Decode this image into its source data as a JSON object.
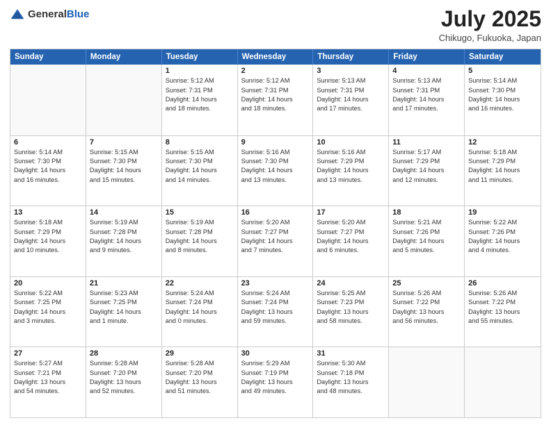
{
  "header": {
    "logo_general": "General",
    "logo_blue": "Blue",
    "month_year": "July 2025",
    "location": "Chikugo, Fukuoka, Japan"
  },
  "days_of_week": [
    "Sunday",
    "Monday",
    "Tuesday",
    "Wednesday",
    "Thursday",
    "Friday",
    "Saturday"
  ],
  "weeks": [
    [
      {
        "day": "",
        "content": []
      },
      {
        "day": "",
        "content": []
      },
      {
        "day": "1",
        "content": [
          "Sunrise: 5:12 AM",
          "Sunset: 7:31 PM",
          "Daylight: 14 hours",
          "and 18 minutes."
        ]
      },
      {
        "day": "2",
        "content": [
          "Sunrise: 5:12 AM",
          "Sunset: 7:31 PM",
          "Daylight: 14 hours",
          "and 18 minutes."
        ]
      },
      {
        "day": "3",
        "content": [
          "Sunrise: 5:13 AM",
          "Sunset: 7:31 PM",
          "Daylight: 14 hours",
          "and 17 minutes."
        ]
      },
      {
        "day": "4",
        "content": [
          "Sunrise: 5:13 AM",
          "Sunset: 7:31 PM",
          "Daylight: 14 hours",
          "and 17 minutes."
        ]
      },
      {
        "day": "5",
        "content": [
          "Sunrise: 5:14 AM",
          "Sunset: 7:30 PM",
          "Daylight: 14 hours",
          "and 16 minutes."
        ]
      }
    ],
    [
      {
        "day": "6",
        "content": [
          "Sunrise: 5:14 AM",
          "Sunset: 7:30 PM",
          "Daylight: 14 hours",
          "and 16 minutes."
        ]
      },
      {
        "day": "7",
        "content": [
          "Sunrise: 5:15 AM",
          "Sunset: 7:30 PM",
          "Daylight: 14 hours",
          "and 15 minutes."
        ]
      },
      {
        "day": "8",
        "content": [
          "Sunrise: 5:15 AM",
          "Sunset: 7:30 PM",
          "Daylight: 14 hours",
          "and 14 minutes."
        ]
      },
      {
        "day": "9",
        "content": [
          "Sunrise: 5:16 AM",
          "Sunset: 7:30 PM",
          "Daylight: 14 hours",
          "and 13 minutes."
        ]
      },
      {
        "day": "10",
        "content": [
          "Sunrise: 5:16 AM",
          "Sunset: 7:29 PM",
          "Daylight: 14 hours",
          "and 13 minutes."
        ]
      },
      {
        "day": "11",
        "content": [
          "Sunrise: 5:17 AM",
          "Sunset: 7:29 PM",
          "Daylight: 14 hours",
          "and 12 minutes."
        ]
      },
      {
        "day": "12",
        "content": [
          "Sunrise: 5:18 AM",
          "Sunset: 7:29 PM",
          "Daylight: 14 hours",
          "and 11 minutes."
        ]
      }
    ],
    [
      {
        "day": "13",
        "content": [
          "Sunrise: 5:18 AM",
          "Sunset: 7:29 PM",
          "Daylight: 14 hours",
          "and 10 minutes."
        ]
      },
      {
        "day": "14",
        "content": [
          "Sunrise: 5:19 AM",
          "Sunset: 7:28 PM",
          "Daylight: 14 hours",
          "and 9 minutes."
        ]
      },
      {
        "day": "15",
        "content": [
          "Sunrise: 5:19 AM",
          "Sunset: 7:28 PM",
          "Daylight: 14 hours",
          "and 8 minutes."
        ]
      },
      {
        "day": "16",
        "content": [
          "Sunrise: 5:20 AM",
          "Sunset: 7:27 PM",
          "Daylight: 14 hours",
          "and 7 minutes."
        ]
      },
      {
        "day": "17",
        "content": [
          "Sunrise: 5:20 AM",
          "Sunset: 7:27 PM",
          "Daylight: 14 hours",
          "and 6 minutes."
        ]
      },
      {
        "day": "18",
        "content": [
          "Sunrise: 5:21 AM",
          "Sunset: 7:26 PM",
          "Daylight: 14 hours",
          "and 5 minutes."
        ]
      },
      {
        "day": "19",
        "content": [
          "Sunrise: 5:22 AM",
          "Sunset: 7:26 PM",
          "Daylight: 14 hours",
          "and 4 minutes."
        ]
      }
    ],
    [
      {
        "day": "20",
        "content": [
          "Sunrise: 5:22 AM",
          "Sunset: 7:25 PM",
          "Daylight: 14 hours",
          "and 3 minutes."
        ]
      },
      {
        "day": "21",
        "content": [
          "Sunrise: 5:23 AM",
          "Sunset: 7:25 PM",
          "Daylight: 14 hours",
          "and 1 minute."
        ]
      },
      {
        "day": "22",
        "content": [
          "Sunrise: 5:24 AM",
          "Sunset: 7:24 PM",
          "Daylight: 14 hours",
          "and 0 minutes."
        ]
      },
      {
        "day": "23",
        "content": [
          "Sunrise: 5:24 AM",
          "Sunset: 7:24 PM",
          "Daylight: 13 hours",
          "and 59 minutes."
        ]
      },
      {
        "day": "24",
        "content": [
          "Sunrise: 5:25 AM",
          "Sunset: 7:23 PM",
          "Daylight: 13 hours",
          "and 58 minutes."
        ]
      },
      {
        "day": "25",
        "content": [
          "Sunrise: 5:26 AM",
          "Sunset: 7:22 PM",
          "Daylight: 13 hours",
          "and 56 minutes."
        ]
      },
      {
        "day": "26",
        "content": [
          "Sunrise: 5:26 AM",
          "Sunset: 7:22 PM",
          "Daylight: 13 hours",
          "and 55 minutes."
        ]
      }
    ],
    [
      {
        "day": "27",
        "content": [
          "Sunrise: 5:27 AM",
          "Sunset: 7:21 PM",
          "Daylight: 13 hours",
          "and 54 minutes."
        ]
      },
      {
        "day": "28",
        "content": [
          "Sunrise: 5:28 AM",
          "Sunset: 7:20 PM",
          "Daylight: 13 hours",
          "and 52 minutes."
        ]
      },
      {
        "day": "29",
        "content": [
          "Sunrise: 5:28 AM",
          "Sunset: 7:20 PM",
          "Daylight: 13 hours",
          "and 51 minutes."
        ]
      },
      {
        "day": "30",
        "content": [
          "Sunrise: 5:29 AM",
          "Sunset: 7:19 PM",
          "Daylight: 13 hours",
          "and 49 minutes."
        ]
      },
      {
        "day": "31",
        "content": [
          "Sunrise: 5:30 AM",
          "Sunset: 7:18 PM",
          "Daylight: 13 hours",
          "and 48 minutes."
        ]
      },
      {
        "day": "",
        "content": []
      },
      {
        "day": "",
        "content": []
      }
    ]
  ]
}
